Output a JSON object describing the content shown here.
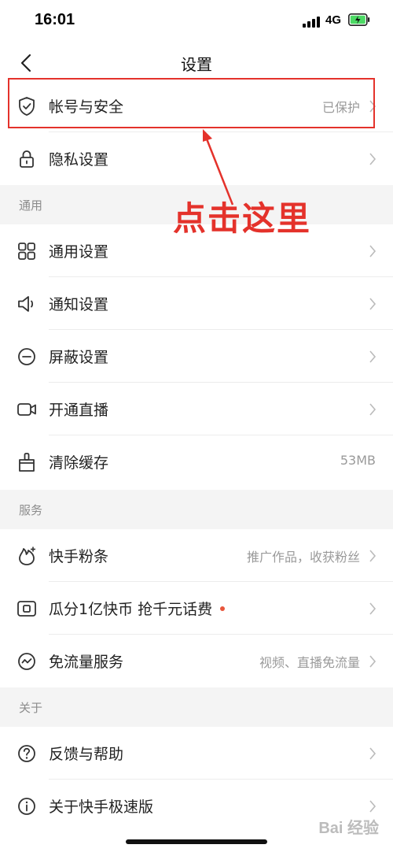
{
  "status_bar": {
    "time": "16:01",
    "network": "4G"
  },
  "nav": {
    "title": "设置"
  },
  "account": [
    {
      "label": "帐号与安全",
      "value": "已保护",
      "icon": "shield-icon"
    },
    {
      "label": "隐私设置",
      "value": "",
      "icon": "lock-icon"
    }
  ],
  "general": {
    "header": "通用",
    "items": [
      {
        "label": "通用设置",
        "value": "",
        "icon": "grid-icon"
      },
      {
        "label": "通知设置",
        "value": "",
        "icon": "speaker-icon"
      },
      {
        "label": "屏蔽设置",
        "value": "",
        "icon": "block-icon"
      },
      {
        "label": "开通直播",
        "value": "",
        "icon": "video-icon"
      },
      {
        "label": "清除缓存",
        "value": "53MB",
        "icon": "broom-icon"
      }
    ]
  },
  "services": {
    "header": "服务",
    "items": [
      {
        "label": "快手粉条",
        "value": "推广作品，收获粉丝",
        "icon": "fire-icon"
      },
      {
        "label": "瓜分1亿快币 抢千元话费",
        "value": "",
        "icon": "coin-icon"
      },
      {
        "label": "免流量服务",
        "value": "视频、直播免流量",
        "icon": "traffic-icon"
      }
    ]
  },
  "about": {
    "header": "关于",
    "items": [
      {
        "label": "反馈与帮助",
        "value": "",
        "icon": "question-icon"
      },
      {
        "label": "关于快手极速版",
        "value": "",
        "icon": "info-icon"
      }
    ]
  },
  "annotation": {
    "text": "点击这里"
  },
  "watermark": "Bai 经验",
  "colors": {
    "annotation_red": "#e4322b",
    "notification_dot": "#e8553b",
    "section_bg": "#f4f4f4"
  }
}
